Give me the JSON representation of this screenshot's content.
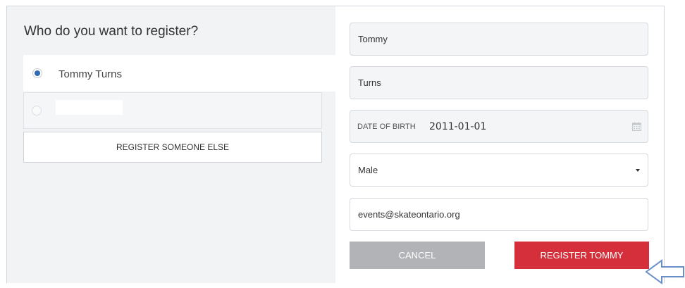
{
  "left": {
    "title": "Who do you want to register?",
    "people": [
      {
        "name": "Tommy Turns",
        "selected": true
      }
    ],
    "register_else_label": "REGISTER SOMEONE ELSE"
  },
  "form": {
    "first_name": "Tommy",
    "last_name": "Turns",
    "dob_label": "DATE OF BIRTH",
    "dob_value": "2011-01-01",
    "gender": "Male",
    "email": "events@skateontario.org"
  },
  "buttons": {
    "cancel": "CANCEL",
    "register": "REGISTER TOMMY"
  },
  "colors": {
    "radio_accent": "#2e6bb3",
    "register_button": "#d42f3a",
    "cancel_button": "#b1b3b6",
    "pointer_arrow": "#6a8fc6"
  },
  "icons": {
    "dob": "calendar-icon",
    "gender": "caret-down-icon",
    "pointer": "arrow-left-icon"
  }
}
